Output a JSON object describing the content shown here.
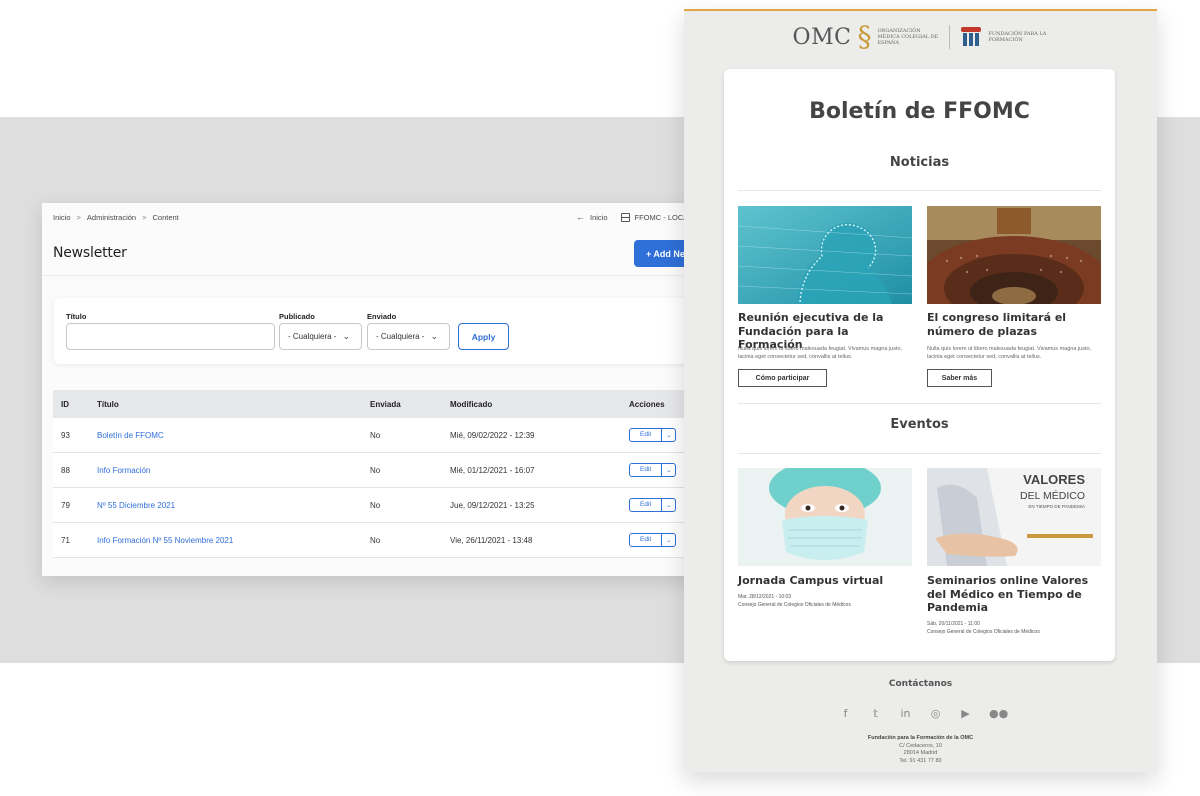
{
  "admin": {
    "breadcrumbs": [
      "Inicio",
      "Administración",
      "Content"
    ],
    "crumb_sep": ">",
    "home_label": "Inicio",
    "site_label": "FFOMC - LOCAL",
    "page_title": "Newsletter",
    "add_button": "+ Add Ne",
    "filters": {
      "title_label": "Título",
      "title_value": "",
      "published_label": "Publicado",
      "published_value": "- Cualquiera -",
      "sent_label": "Enviado",
      "sent_value": "- Cualquiera -",
      "apply_label": "Apply"
    },
    "table": {
      "headers": [
        "ID",
        "Título",
        "Enviada",
        "Modificado",
        "Acciones"
      ],
      "rows": [
        {
          "id": "93",
          "title": "Boletín de FFOMC",
          "sent": "No",
          "modified": "Mié, 09/02/2022 - 12:39",
          "action": "Edit"
        },
        {
          "id": "88",
          "title": "Info Formación",
          "sent": "No",
          "modified": "Mié, 01/12/2021 - 16:07",
          "action": "Edit"
        },
        {
          "id": "79",
          "title": "Nº 55 Diciembre 2021",
          "sent": "No",
          "modified": "Jue, 09/12/2021 - 13:25",
          "action": "Edit"
        },
        {
          "id": "71",
          "title": "Info Formación Nº 55 Noviembre 2021",
          "sent": "No",
          "modified": "Vie, 26/11/2021 - 13:48",
          "action": "Edit"
        }
      ]
    }
  },
  "newsletter": {
    "brand": {
      "omc": "OMC",
      "org_name": "Organización Médica Colegial de España",
      "fund_name": "Fundación para la Formación",
      "accent": "#e0a548"
    },
    "title": "Boletín de FFOMC",
    "news_heading": "Noticias",
    "news": [
      {
        "title": "Reunión ejecutiva de la Fundación para la Formación",
        "text": "Nulla quis lorem ut libero malesuada feugiat. Vivamus magna justo, lacinia eget consectetur sed, convallis at tellus.",
        "button": "Cómo participar"
      },
      {
        "title": "El congreso limitará el número de plazas",
        "text": "Nulla quis lorem ut libero malesuada feugiat. Vivamus magna justo, lacinia eget consectetur sed, convallis at tellus.",
        "button": "Saber más"
      }
    ],
    "events_heading": "Eventos",
    "events": [
      {
        "title": "Jornada Campus virtual",
        "date": "Mar, 28/12/2021 - 10:03",
        "org": "Consejo General de Colegios Oficiales de Médicos"
      },
      {
        "title": "Seminarios online Valores del Médico en Tiempo de Pandemia",
        "date": "Sáb, 20/11/2021 - 11:00",
        "org": "Consejo General de Colegios Oficiales de Médicos"
      }
    ],
    "event_image_text": {
      "l1": "VALORES",
      "l2": "DEL MÉDICO",
      "l3": "EN TIEMPO DE PANDEMIA"
    },
    "contact_heading": "Contáctanos",
    "social_icons": [
      "facebook-icon",
      "twitter-icon",
      "linkedin-icon",
      "instagram-icon",
      "youtube-icon",
      "flickr-icon"
    ],
    "address": {
      "name": "Fundación para la Formación de la OMC",
      "street": "C/ Cedaceros, 10",
      "city": "28014 Madrid",
      "phone": "Tel. 91 431 77 80"
    }
  }
}
